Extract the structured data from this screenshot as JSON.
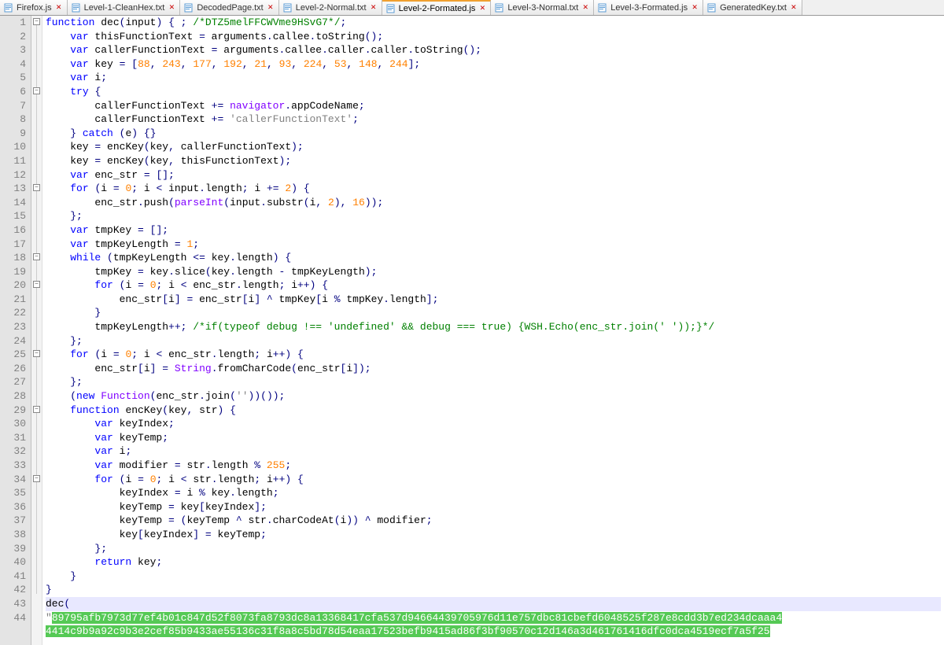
{
  "tabs": [
    {
      "label": "Firefox.js",
      "active": false
    },
    {
      "label": "Level-1-CleanHex.txt",
      "active": false
    },
    {
      "label": "DecodedPage.txt",
      "active": false
    },
    {
      "label": "Level-2-Normal.txt",
      "active": false
    },
    {
      "label": "Level-2-Formated.js",
      "active": true
    },
    {
      "label": "Level-3-Normal.txt",
      "active": false
    },
    {
      "label": "Level-3-Formated.js",
      "active": false
    },
    {
      "label": "GeneratedKey.txt",
      "active": false
    }
  ],
  "code": {
    "line_count": 44,
    "key_array": "[88, 243, 177, 192, 21, 93, 224, 53, 148, 244]",
    "comment1": "/*DTZ5melFFCWVme9HSvG7*/",
    "string1": "'callerFunctionText'",
    "string2": "'undefined'",
    "string3": "''",
    "string4": "' '",
    "comment2": "/*if(typeof debug !== 'undefined' && debug === true) {WSH.Echo(enc_str.join(' '));}*/",
    "hex1": "89795afb7973d77ef4b01c847d52f8073fa8793dc8a13368417cfa537d94664439705976d11e757dbc81cbefd6048525f287e8cdd3b7ed234dcaaa4",
    "hex2": "4414c9b9a92c9b3e2cef85b9433ae55136c31f8a8c5bd78d54eaa17523befb9415ad86f3bf90570c12d146a3d461761416dfc0dca4519ecf7a5f25"
  }
}
